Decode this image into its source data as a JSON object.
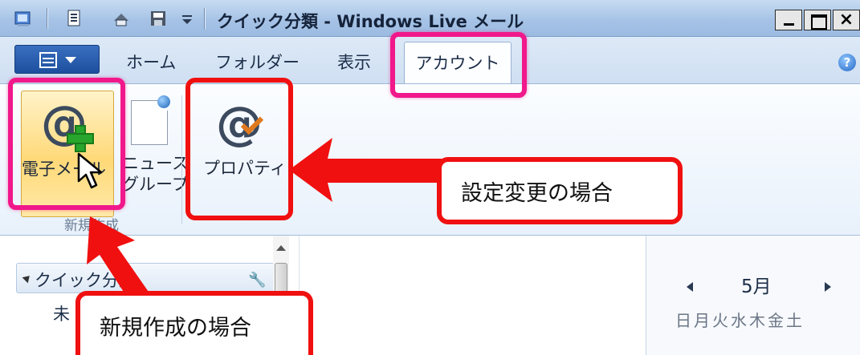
{
  "window": {
    "title": "クイック分類 - Windows Live メール",
    "close_glyph": "×"
  },
  "ribbon_tabs": {
    "home": "ホーム",
    "folder": "フォルダー",
    "view": "表示",
    "account": "アカウント",
    "active": "アカウント"
  },
  "ribbon": {
    "email_label_line1": "電子メール",
    "news_label_line1": "ニュース",
    "news_label_line2": "グループ",
    "new_group_label": "新規作成",
    "properties_label": "プロパティ"
  },
  "folder_pane": {
    "header": "クイック分類",
    "item_fragment": "未"
  },
  "calendar": {
    "month": "5月",
    "weekdays": [
      "日",
      "月",
      "火",
      "水",
      "木",
      "金",
      "土"
    ]
  },
  "callouts": {
    "settings_change": "設定変更の場合",
    "new_create": "新規作成の場合"
  },
  "colors": {
    "highlight_pink": "#f0188a",
    "annotation_red": "#f01010",
    "email_button_active": "#ffd978"
  },
  "icons": {
    "app": "windows-live-mail-icon",
    "email": "at-sign-plus-icon",
    "properties": "at-sign-check-icon",
    "news": "newsgroup-icon",
    "help": "help-icon",
    "cursor": "mouse-pointer-icon"
  }
}
